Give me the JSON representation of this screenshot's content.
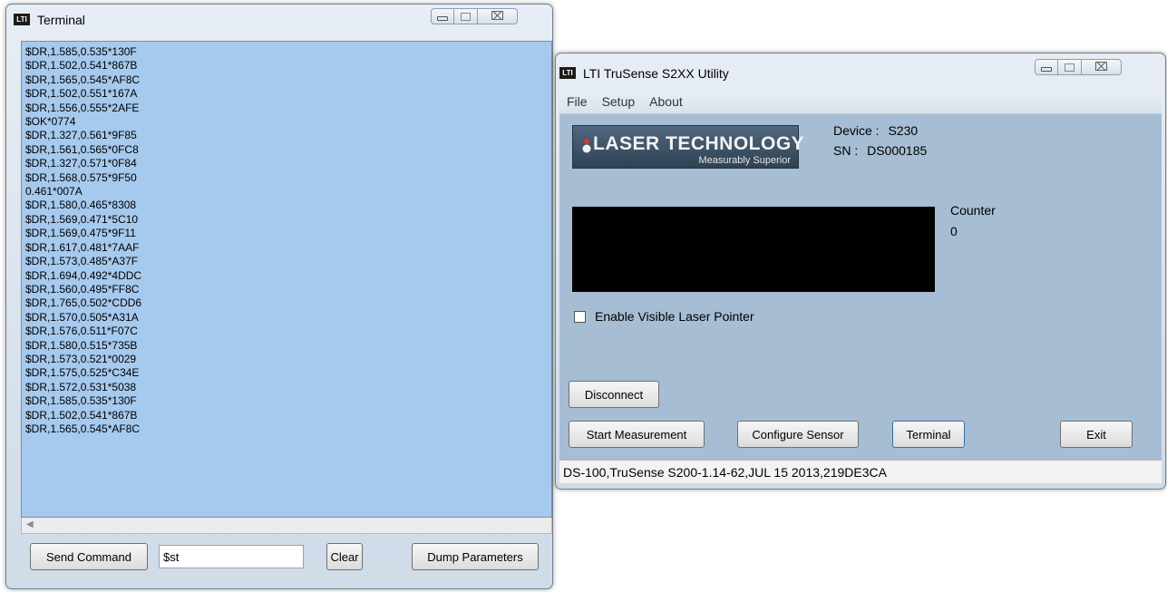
{
  "terminal": {
    "app_icon": "LTI",
    "title": "Terminal",
    "lines": [
      "$DR,1.585,0.535*130F",
      "$DR,1.502,0.541*867B",
      "$DR,1.565,0.545*AF8C",
      "$DR,1.502,0.551*167A",
      "$DR,1.556,0.555*2AFE",
      "$OK*0774",
      "$DR,1.327,0.561*9F85",
      "$DR,1.561,0.565*0FC8",
      "$DR,1.327,0.571*0F84",
      "$DR,1.568,0.575*9F50",
      "0.461*007A",
      "$DR,1.580,0.465*8308",
      "$DR,1.569,0.471*5C10",
      "$DR,1.569,0.475*9F11",
      "$DR,1.617,0.481*7AAF",
      "$DR,1.573,0.485*A37F",
      "$DR,1.694,0.492*4DDC",
      "$DR,1.560,0.495*FF8C",
      "$DR,1.765,0.502*CDD6",
      "$DR,1.570,0.505*A31A",
      "$DR,1.576,0.511*F07C",
      "$DR,1.580,0.515*735B",
      "$DR,1.573,0.521*0029",
      "$DR,1.575,0.525*C34E",
      "$DR,1.572,0.531*5038",
      "$DR,1.585,0.535*130F",
      "$DR,1.502,0.541*867B",
      "$DR,1.565,0.545*AF8C"
    ],
    "send_button": "Send Command",
    "command_value": "$st",
    "clear_button": "Clear",
    "dump_button": "Dump Parameters"
  },
  "utility": {
    "app_icon": "LTI",
    "title": "LTI TruSense S2XX Utility",
    "menu": [
      "File",
      "Setup",
      "About"
    ],
    "logo_text": "LASER TECHNOLOGY",
    "logo_tagline": "Measurably Superior",
    "device_label": "Device :",
    "device_value": "S230",
    "sn_label": "SN :",
    "sn_value": "DS000185",
    "counter_label": "Counter",
    "counter_value": "0",
    "laser_pointer_label": "Enable Visible Laser Pointer",
    "laser_pointer_checked": false,
    "disconnect_button": "Disconnect",
    "start_button": "Start Measurement",
    "configure_button": "Configure Sensor",
    "terminal_button": "Terminal",
    "exit_button": "Exit",
    "status_text": "DS-100,TruSense S200-1.14-62,JUL 15 2013,219DE3CA"
  },
  "window_controls": {
    "minimize": "minimize-icon",
    "maximize": "maximize-icon",
    "close": "close-icon",
    "close_glyph": "⌧"
  },
  "colors": {
    "terminal_bg": "#a6c9ee",
    "utility_bg": "#a6bdd4",
    "display_bg": "#000000"
  }
}
